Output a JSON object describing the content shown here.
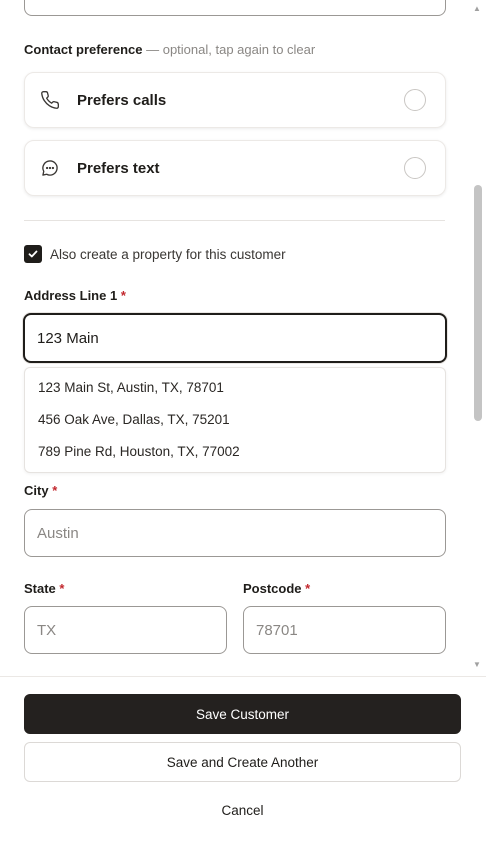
{
  "contact_preference": {
    "label": "Contact preference",
    "hint": "— optional, tap again to clear",
    "options": [
      {
        "label": "Prefers calls",
        "icon": "phone-icon",
        "selected": false
      },
      {
        "label": "Prefers text",
        "icon": "chat-bubble-icon",
        "selected": false
      }
    ]
  },
  "create_property": {
    "label": "Also create a property for this customer",
    "checked": true
  },
  "address_line1": {
    "label": "Address Line 1",
    "required_mark": "*",
    "value": "123 Main"
  },
  "suggestions": [
    "123 Main St, Austin, TX, 78701",
    "456 Oak Ave, Dallas, TX, 75201",
    "789 Pine Rd, Houston, TX, 77002"
  ],
  "city": {
    "label": "City",
    "required_mark": "*",
    "placeholder": "Austin"
  },
  "state": {
    "label": "State",
    "required_mark": "*",
    "placeholder": "TX"
  },
  "postcode": {
    "label": "Postcode",
    "required_mark": "*",
    "placeholder": "78701"
  },
  "actions": {
    "save_label": "Save Customer",
    "save_another_label": "Save and Create Another",
    "cancel_label": "Cancel"
  },
  "colors": {
    "primary": "#24211f",
    "required": "#c2272d",
    "muted": "#8a8784"
  }
}
